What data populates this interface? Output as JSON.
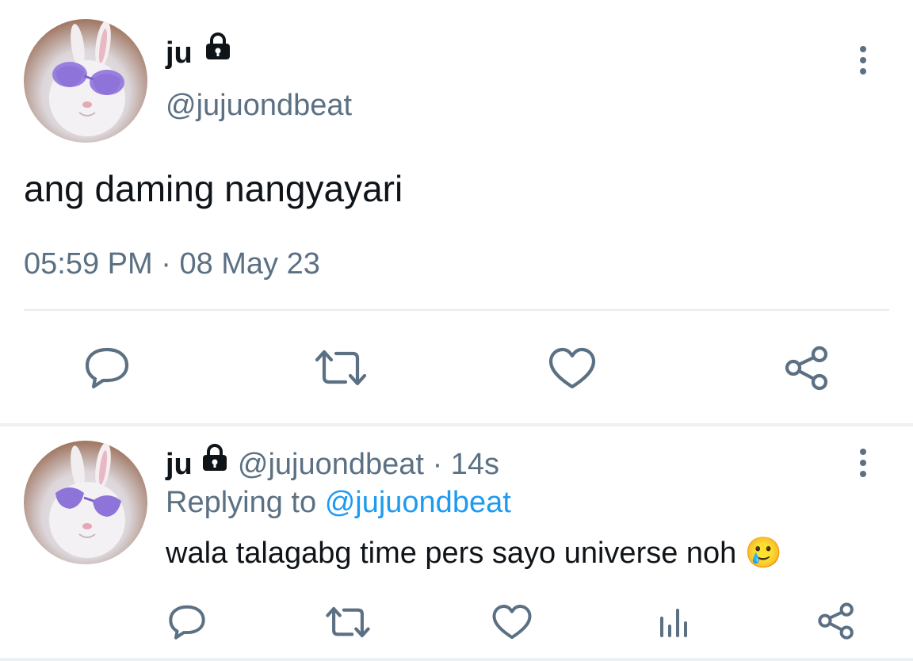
{
  "main_tweet": {
    "display_name": "ju",
    "handle": "@jujuondbeat",
    "text": "ang daming nangyayari",
    "time": "05:59 PM",
    "separator": "·",
    "date": "08 May 23",
    "actions": [
      "reply-icon",
      "retweet-icon",
      "like-icon",
      "share-icon"
    ]
  },
  "reply_tweet": {
    "display_name": "ju",
    "handle": "@jujuondbeat",
    "separator": "·",
    "age": "14s",
    "replying_prefix": "Replying to",
    "replying_to": "@jujuondbeat",
    "text": "wala talagabg time pers sayo universe noh",
    "emoji": "🥲",
    "actions": [
      "reply-icon",
      "retweet-icon",
      "like-icon",
      "analytics-icon",
      "share-icon"
    ]
  },
  "colors": {
    "text": "#0f1419",
    "secondary": "#5b7083",
    "link": "#1d9bf0",
    "divider": "#e6ecf0"
  }
}
